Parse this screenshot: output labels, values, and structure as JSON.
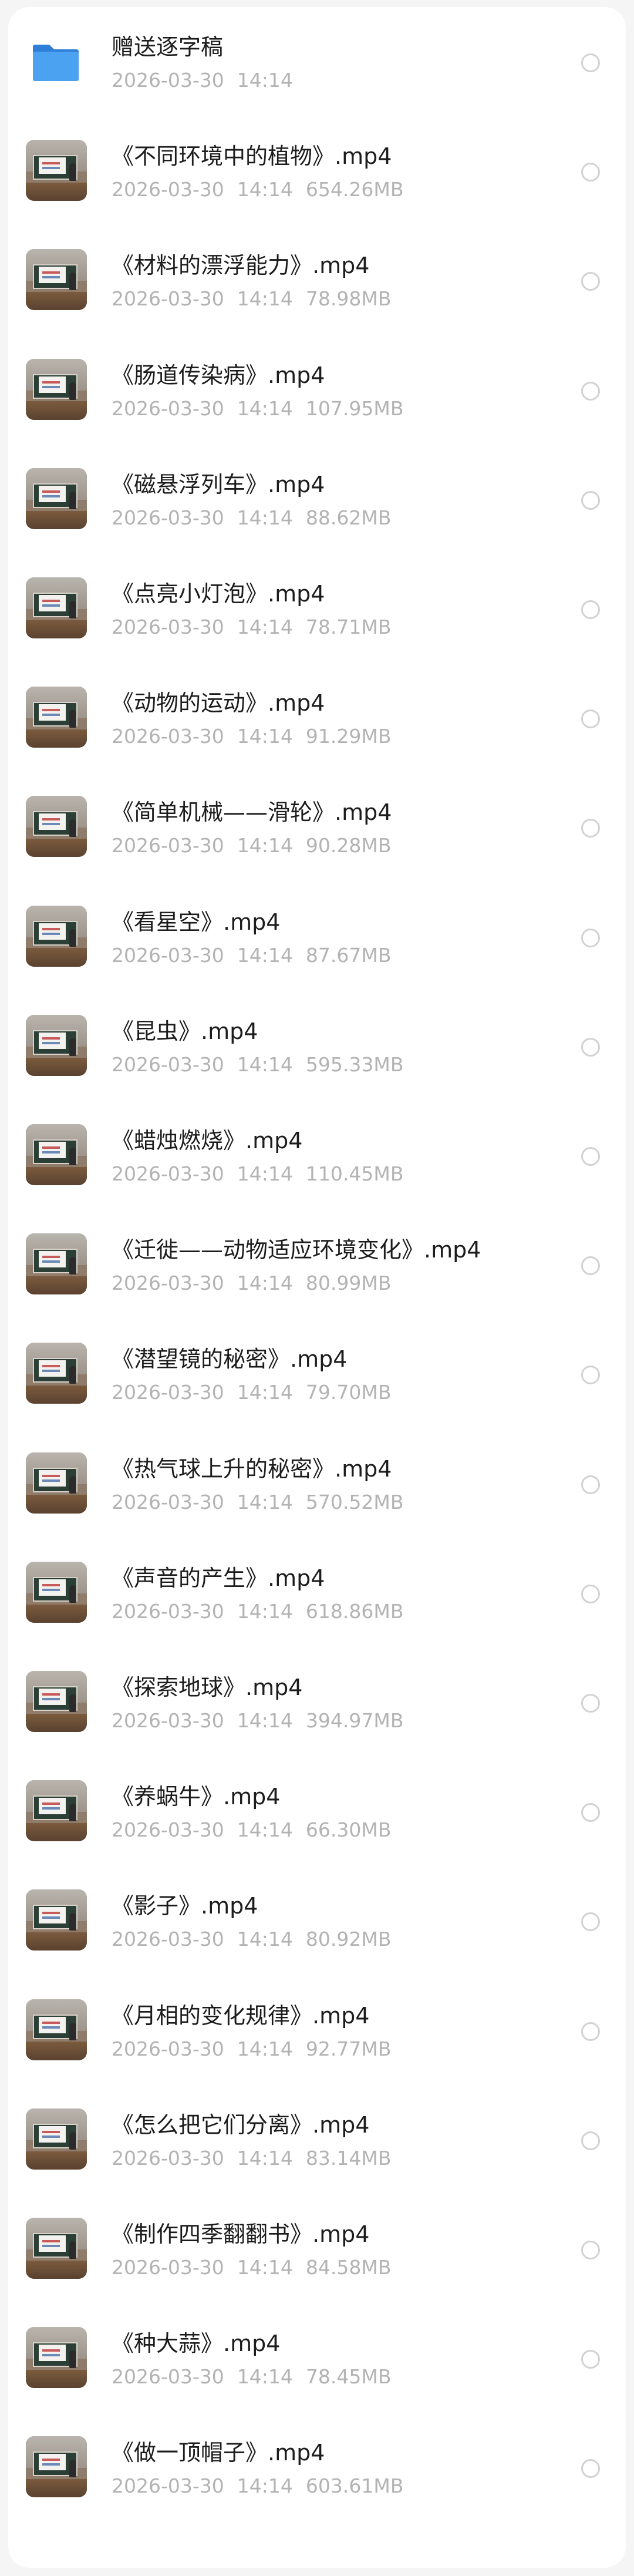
{
  "items": [
    {
      "type": "folder",
      "icon": "folder-icon",
      "title": "赠送逐字稿",
      "date": "2026-03-30",
      "time": "14:14",
      "size": ""
    },
    {
      "type": "video",
      "icon": "video-thumbnail",
      "title": "《不同环境中的植物》.mp4",
      "date": "2026-03-30",
      "time": "14:14",
      "size": "654.26MB"
    },
    {
      "type": "video",
      "icon": "video-thumbnail",
      "title": "《材料的漂浮能力》.mp4",
      "date": "2026-03-30",
      "time": "14:14",
      "size": "78.98MB"
    },
    {
      "type": "video",
      "icon": "video-thumbnail",
      "title": "《肠道传染病》.mp4",
      "date": "2026-03-30",
      "time": "14:14",
      "size": "107.95MB"
    },
    {
      "type": "video",
      "icon": "video-thumbnail",
      "title": "《磁悬浮列车》.mp4",
      "date": "2026-03-30",
      "time": "14:14",
      "size": "88.62MB"
    },
    {
      "type": "video",
      "icon": "video-thumbnail",
      "title": "《点亮小灯泡》.mp4",
      "date": "2026-03-30",
      "time": "14:14",
      "size": "78.71MB"
    },
    {
      "type": "video",
      "icon": "video-thumbnail",
      "title": "《动物的运动》.mp4",
      "date": "2026-03-30",
      "time": "14:14",
      "size": "91.29MB"
    },
    {
      "type": "video",
      "icon": "video-thumbnail",
      "title": "《简单机械——滑轮》.mp4",
      "date": "2026-03-30",
      "time": "14:14",
      "size": "90.28MB"
    },
    {
      "type": "video",
      "icon": "video-thumbnail",
      "title": "《看星空》.mp4",
      "date": "2026-03-30",
      "time": "14:14",
      "size": "87.67MB"
    },
    {
      "type": "video",
      "icon": "video-thumbnail",
      "title": "《昆虫》.mp4",
      "date": "2026-03-30",
      "time": "14:14",
      "size": "595.33MB"
    },
    {
      "type": "video",
      "icon": "video-thumbnail",
      "title": "《蜡烛燃烧》.mp4",
      "date": "2026-03-30",
      "time": "14:14",
      "size": "110.45MB"
    },
    {
      "type": "video",
      "icon": "video-thumbnail",
      "title": "《迁徙——动物适应环境变化》.mp4",
      "date": "2026-03-30",
      "time": "14:14",
      "size": "80.99MB"
    },
    {
      "type": "video",
      "icon": "video-thumbnail",
      "title": "《潜望镜的秘密》.mp4",
      "date": "2026-03-30",
      "time": "14:14",
      "size": "79.70MB"
    },
    {
      "type": "video",
      "icon": "video-thumbnail",
      "title": "《热气球上升的秘密》.mp4",
      "date": "2026-03-30",
      "time": "14:14",
      "size": "570.52MB"
    },
    {
      "type": "video",
      "icon": "video-thumbnail",
      "title": "《声音的产生》.mp4",
      "date": "2026-03-30",
      "time": "14:14",
      "size": "618.86MB"
    },
    {
      "type": "video",
      "icon": "video-thumbnail",
      "title": "《探索地球》.mp4",
      "date": "2026-03-30",
      "time": "14:14",
      "size": "394.97MB"
    },
    {
      "type": "video",
      "icon": "video-thumbnail",
      "title": "《养蜗牛》.mp4",
      "date": "2026-03-30",
      "time": "14:14",
      "size": "66.30MB"
    },
    {
      "type": "video",
      "icon": "video-thumbnail",
      "title": "《影子》.mp4",
      "date": "2026-03-30",
      "time": "14:14",
      "size": "80.92MB"
    },
    {
      "type": "video",
      "icon": "video-thumbnail",
      "title": "《月相的变化规律》.mp4",
      "date": "2026-03-30",
      "time": "14:14",
      "size": "92.77MB"
    },
    {
      "type": "video",
      "icon": "video-thumbnail",
      "title": "《怎么把它们分离》.mp4",
      "date": "2026-03-30",
      "time": "14:14",
      "size": "83.14MB"
    },
    {
      "type": "video",
      "icon": "video-thumbnail",
      "title": "《制作四季翻翻书》.mp4",
      "date": "2026-03-30",
      "time": "14:14",
      "size": "84.58MB"
    },
    {
      "type": "video",
      "icon": "video-thumbnail",
      "title": "《种大蒜》.mp4",
      "date": "2026-03-30",
      "time": "14:14",
      "size": "78.45MB"
    },
    {
      "type": "video",
      "icon": "video-thumbnail",
      "title": "《做一顶帽子》.mp4",
      "date": "2026-03-30",
      "time": "14:14",
      "size": "603.61MB"
    }
  ],
  "colors": {
    "title": "#1c1c1c",
    "meta": "#b3b3b3",
    "folder": "#3a8ee6",
    "radio_border": "#d2d2d2",
    "background": "#f5f5f5"
  }
}
